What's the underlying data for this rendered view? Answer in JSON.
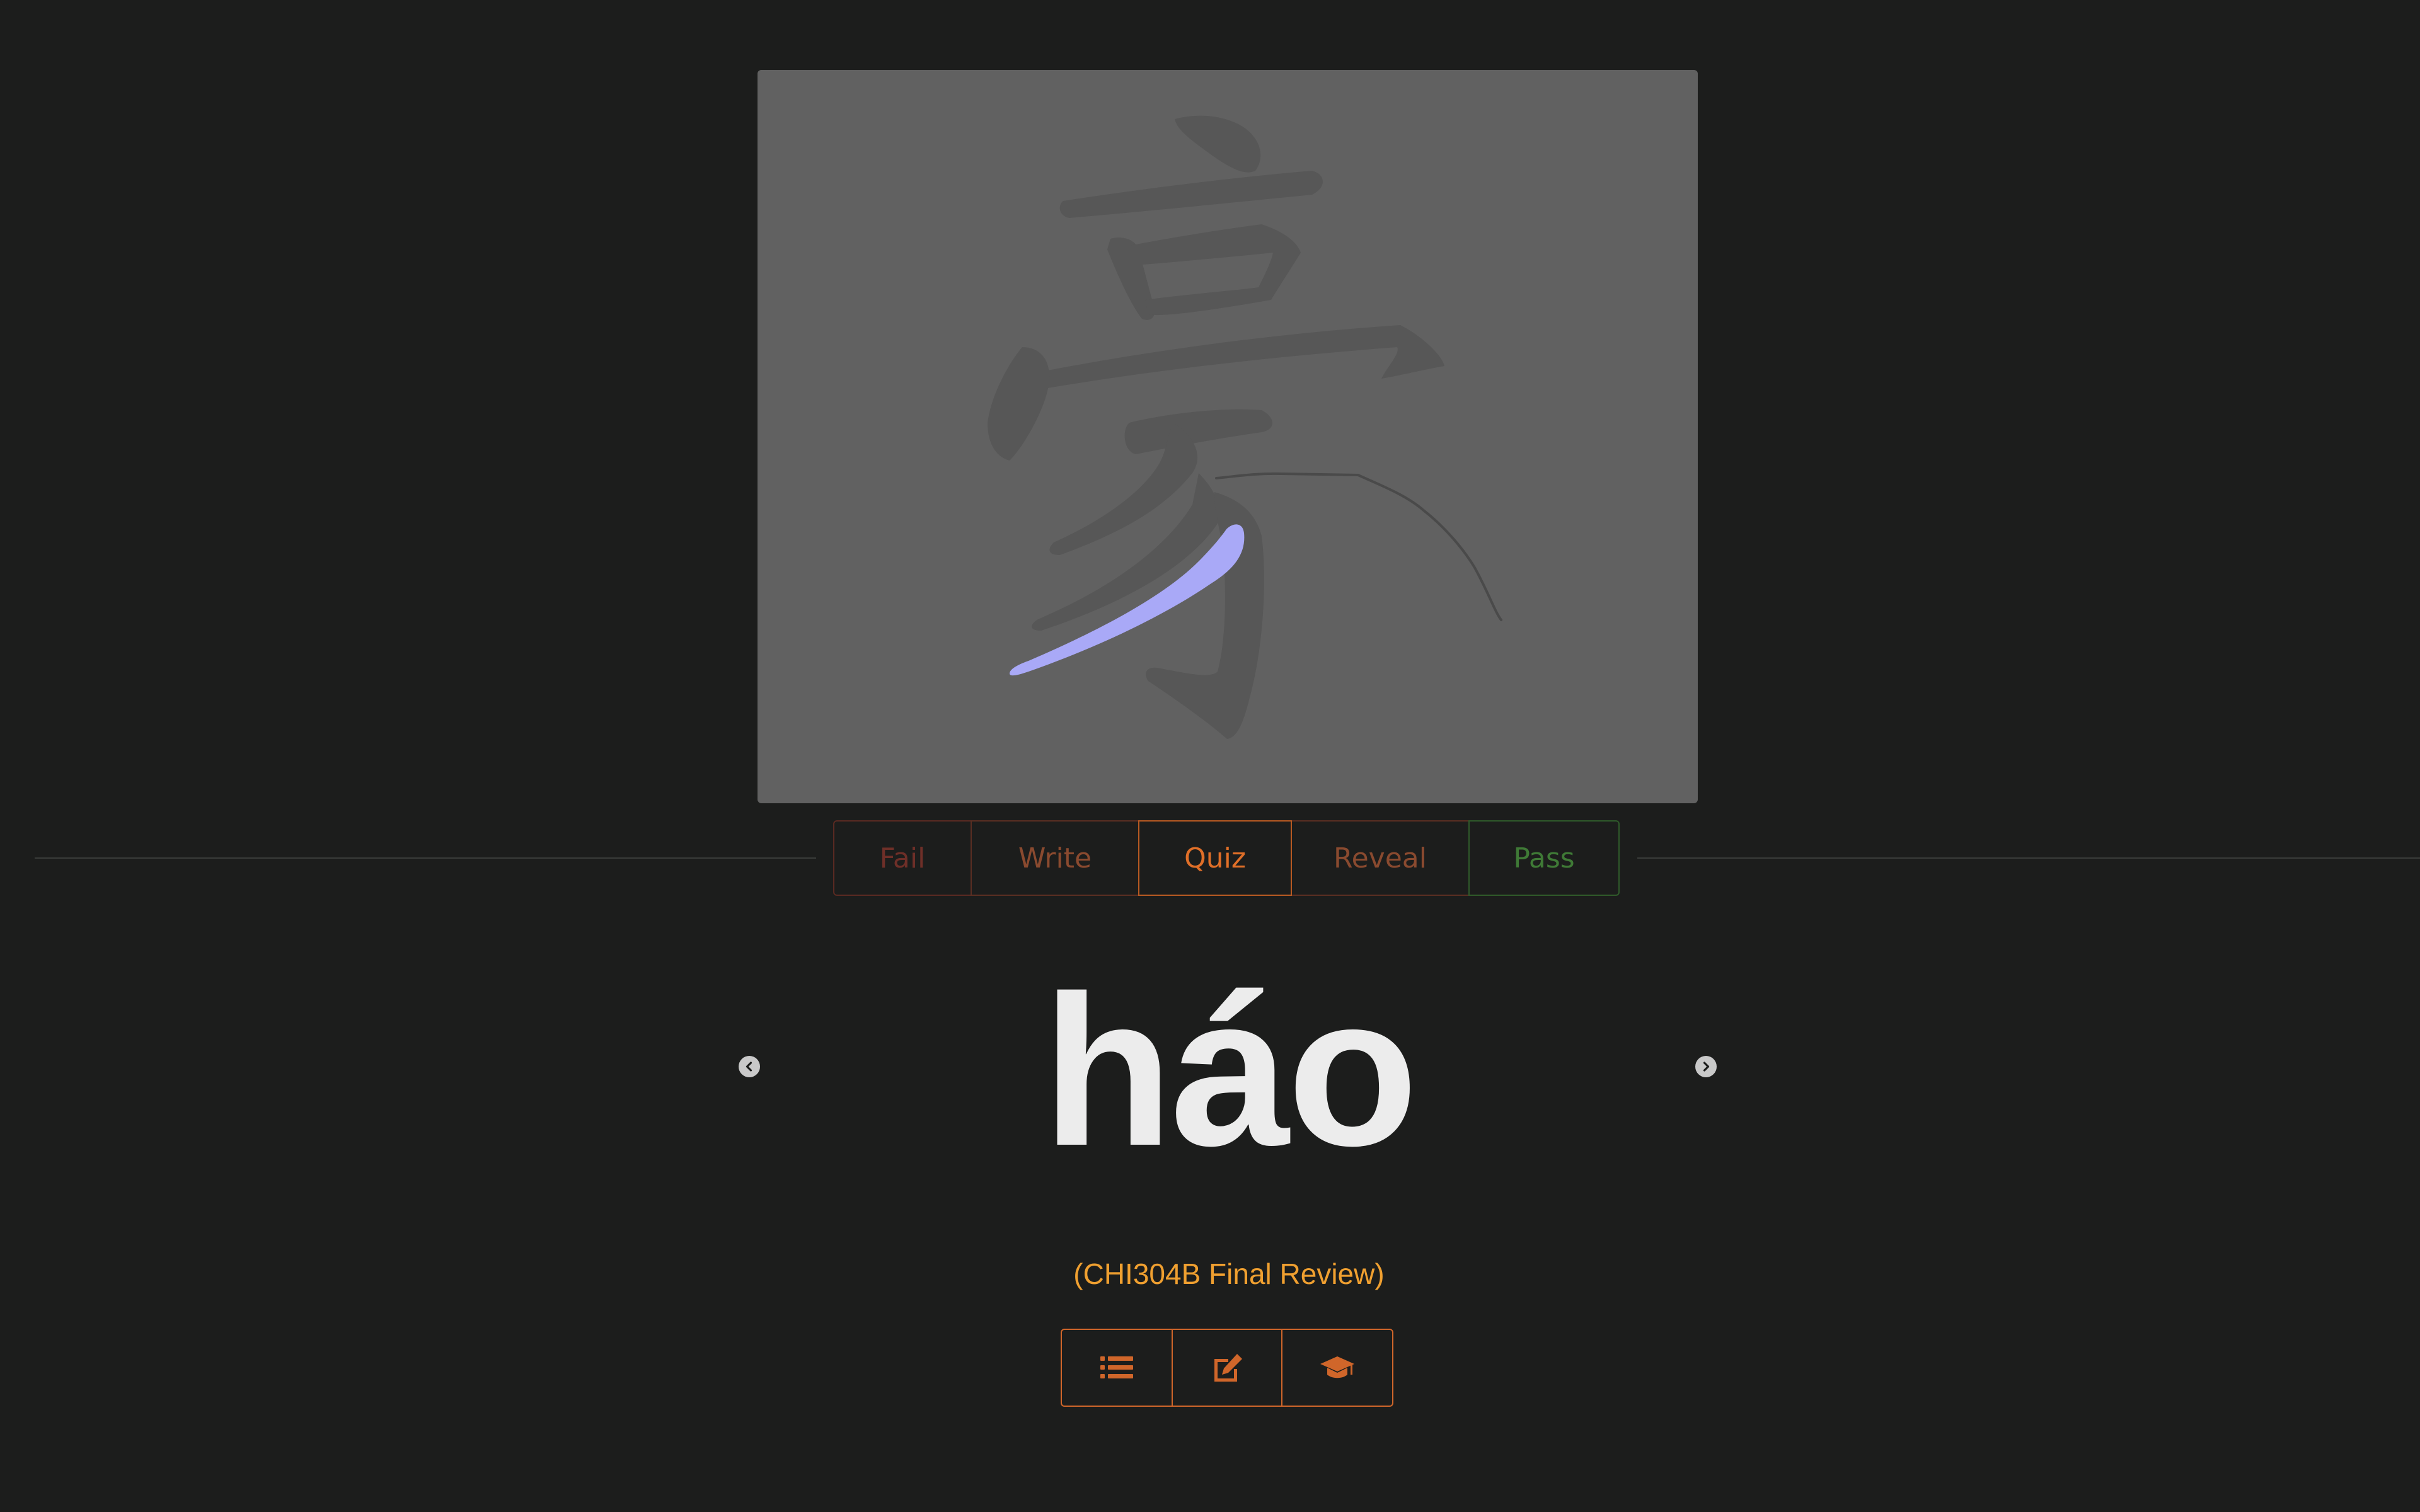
{
  "character": {
    "glyph": "豪",
    "stroke_color": "#a9a9f7",
    "guide_color": "#575757",
    "canvas_color": "#616161"
  },
  "modes": {
    "fail": "Fail",
    "write": "Write",
    "quiz": "Quiz",
    "reveal": "Reveal",
    "pass": "Pass",
    "active": "Quiz"
  },
  "card": {
    "pinyin": "háo",
    "deck": "(CHI304B Final Review)"
  },
  "icons": {
    "prev": "chevron-left-circle-icon",
    "next": "chevron-right-circle-icon",
    "list": "list-icon",
    "edit": "edit-icon",
    "study": "graduation-cap-icon"
  },
  "colors": {
    "background": "#1c1d1c",
    "accent": "#e06f28",
    "fail": "#6e2f28",
    "pass": "#3f7a36",
    "deck": "#f0a030",
    "text": "#ececec"
  }
}
